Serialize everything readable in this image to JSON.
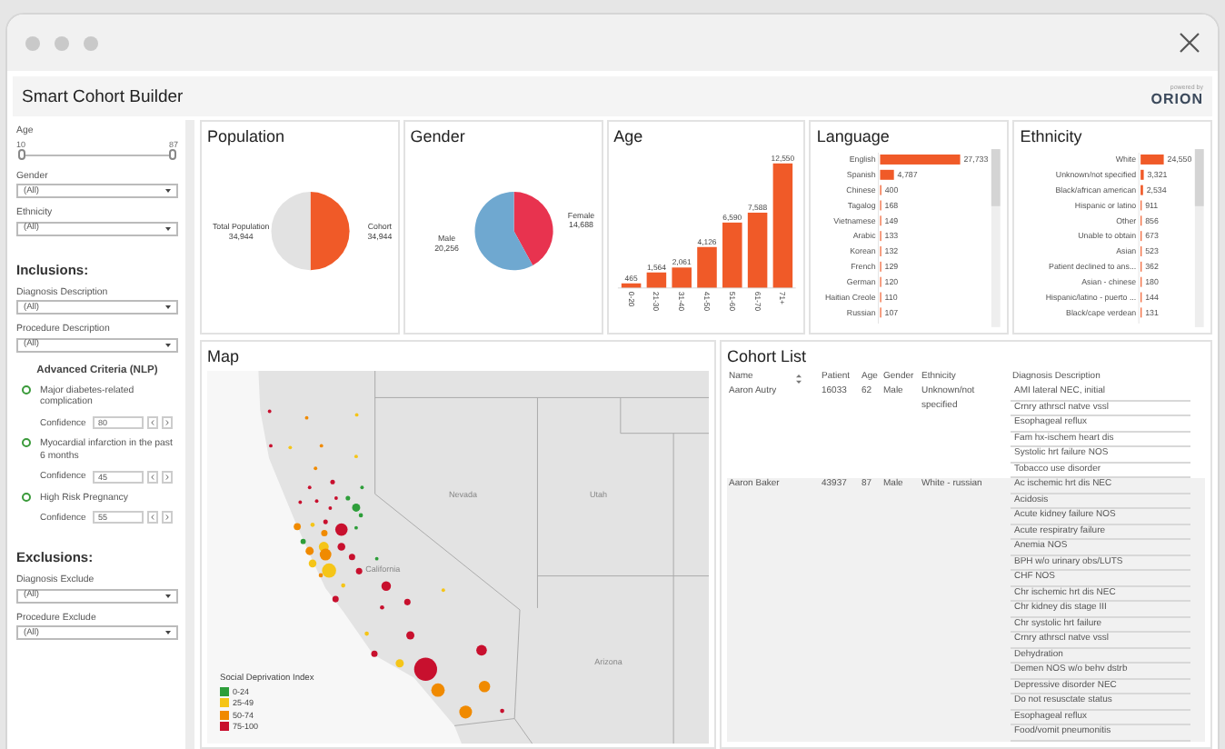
{
  "app": {
    "title": "Smart Cohort Builder",
    "logo": {
      "caption": "powered by",
      "name": "ORION"
    }
  },
  "sidebar": [
    {
      "kind": "range",
      "label": "Age",
      "min": "10",
      "max": "87",
      "level": 1
    },
    {
      "kind": "dropdown",
      "label": "Gender",
      "value": "(All)"
    },
    {
      "kind": "dropdown",
      "label": "Ethnicity",
      "value": "(All)"
    },
    {
      "kind": "heading",
      "text": "Inclusions:"
    },
    {
      "kind": "dropdown",
      "label": "Diagnosis Description",
      "value": "(All)"
    },
    {
      "kind": "dropdown",
      "label": "Procedure Description",
      "value": "(All)"
    },
    {
      "kind": "subheading",
      "text": "Advanced Criteria (NLP)"
    },
    {
      "kind": "criterion",
      "label": "Major diabetes-related complication",
      "checked": false,
      "confidence_label": "Confidence",
      "confidence": "80"
    },
    {
      "kind": "criterion",
      "label": "Myocardial infarction in the past 6 months",
      "checked": false,
      "confidence_label": "Confidence",
      "confidence": "45"
    },
    {
      "kind": "criterion",
      "label": "High Risk Pregnancy",
      "checked": false,
      "confidence_label": "Confidence",
      "confidence": "55"
    },
    {
      "kind": "heading",
      "text": "Exclusions:"
    },
    {
      "kind": "dropdown",
      "label": "Diagnosis Exclude",
      "value": "(All)"
    },
    {
      "kind": "dropdown",
      "label": "Procedure Exclude",
      "value": "(All)"
    }
  ],
  "charts": [
    {
      "title": "Population",
      "chart_data": {
        "type": "pie",
        "categories": [
          "Cohort",
          "Total Population"
        ],
        "values": [
          34944,
          34944
        ],
        "value_labels": [
          "34,944",
          "34,944"
        ]
      }
    },
    {
      "title": "Gender",
      "chart_data": {
        "type": "pie",
        "categories": [
          "Female",
          "Male"
        ],
        "values": [
          14688,
          20256
        ],
        "value_labels": [
          "14,688",
          "20,256"
        ]
      }
    },
    {
      "title": "Age",
      "chart_data": {
        "type": "bar",
        "categories": [
          "0-20",
          "21-30",
          "31-40",
          "41-50",
          "51-60",
          "61-70",
          "71+"
        ],
        "values": [
          465,
          1564,
          2061,
          4126,
          6590,
          7588,
          12550
        ],
        "value_labels": [
          "465",
          "1,564",
          "2,061",
          "4,126",
          "6,590",
          "7,588",
          "12,550"
        ]
      }
    },
    {
      "title": "Language",
      "chart_data": {
        "type": "bar",
        "orientation": "horizontal",
        "categories": [
          "English",
          "Spanish",
          "Chinese",
          "Tagalog",
          "Vietnamese",
          "Arabic",
          "Korean",
          "French",
          "German",
          "Haitian Creole",
          "Russian"
        ],
        "values": [
          27733,
          4787,
          400,
          168,
          149,
          133,
          132,
          129,
          120,
          110,
          107
        ],
        "value_labels": [
          "27,733",
          "4,787",
          "400",
          "168",
          "149",
          "133",
          "132",
          "129",
          "120",
          "110",
          "107"
        ]
      }
    },
    {
      "title": "Ethnicity",
      "chart_data": {
        "type": "bar",
        "orientation": "horizontal",
        "categories": [
          "White",
          "Unknown/not specified",
          "Black/african american",
          "Hispanic or latino",
          "Other",
          "Unable to obtain",
          "Asian",
          "Patient declined to ans...",
          "Asian - chinese",
          "Hispanic/latino - puerto ...",
          "Black/cape verdean"
        ],
        "values": [
          24550,
          3321,
          2534,
          911,
          856,
          673,
          523,
          362,
          180,
          144,
          131
        ],
        "value_labels": [
          "24,550",
          "3,321",
          "2,534",
          "911",
          "856",
          "673",
          "523",
          "362",
          "180",
          "144",
          "131"
        ]
      }
    }
  ],
  "map": {
    "title": "Map",
    "labels": [
      "Nevada",
      "Utah",
      "California",
      "Arizona"
    ],
    "legend": {
      "title": "Social Deprivation Index",
      "items": [
        {
          "label": "0-24",
          "color": "#2e9e3a"
        },
        {
          "label": "25-49",
          "color": "#f5c518"
        },
        {
          "label": "50-74",
          "color": "#f08a00"
        },
        {
          "label": "75-100",
          "color": "#c8102e"
        }
      ]
    }
  },
  "cohort_list": {
    "title": "Cohort List",
    "columns": [
      "Name",
      "Patient",
      "Age",
      "Gender",
      "Ethnicity",
      "Diagnosis Description"
    ],
    "rows": [
      {
        "selected": false,
        "cells": [
          "Aaron Autry",
          "16033",
          "62",
          "Male",
          "Unknown/not specified"
        ],
        "diagnoses": [
          "AMI lateral NEC, initial",
          "Crnry athrscl natve vssl",
          "Esophageal reflux",
          "Fam hx-ischem heart dis",
          "Systolic hrt failure NOS",
          "Tobacco use disorder"
        ]
      },
      {
        "selected": true,
        "cells": [
          "Aaron Baker",
          "43937",
          "87",
          "Male",
          "White - russian"
        ],
        "diagnoses": [
          "Ac ischemic hrt dis NEC",
          "Acidosis",
          "Acute kidney failure NOS",
          "Acute respiratry failure",
          "Anemia NOS",
          "BPH w/o urinary obs/LUTS",
          "CHF NOS",
          "Chr ischemic hrt dis NEC",
          "Chr kidney dis stage III",
          "Chr systolic hrt failure",
          "Crnry athrscl natve vssl",
          "Dehydration",
          "Demen NOS w/o behv dstrb",
          "Depressive disorder NEC",
          "Do not resusctate status",
          "Esophageal reflux",
          "Food/vomit pneumonitis"
        ]
      }
    ]
  }
}
